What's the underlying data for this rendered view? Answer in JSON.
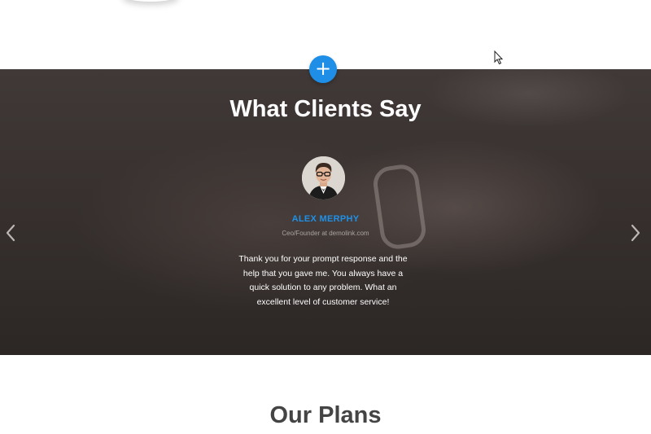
{
  "testimonials": {
    "title": "What Clients Say",
    "add_button_icon": "plus-icon",
    "add_button_label": "+",
    "client": {
      "name": "ALEX MERPHY",
      "role": "Ceo/Founder at demolink.com",
      "quote": "Thank you for your prompt response and the help that you gave me. You always have a quick solution to any problem. What an excellent level of customer service!"
    },
    "prev_icon": "chevron-left-icon",
    "next_icon": "chevron-right-icon"
  },
  "plans": {
    "title": "Our Plans"
  },
  "colors": {
    "accent": "#1e8ee6",
    "name_color": "#1e90e8",
    "overlay": "#37302e",
    "heading_dark": "#444444"
  }
}
